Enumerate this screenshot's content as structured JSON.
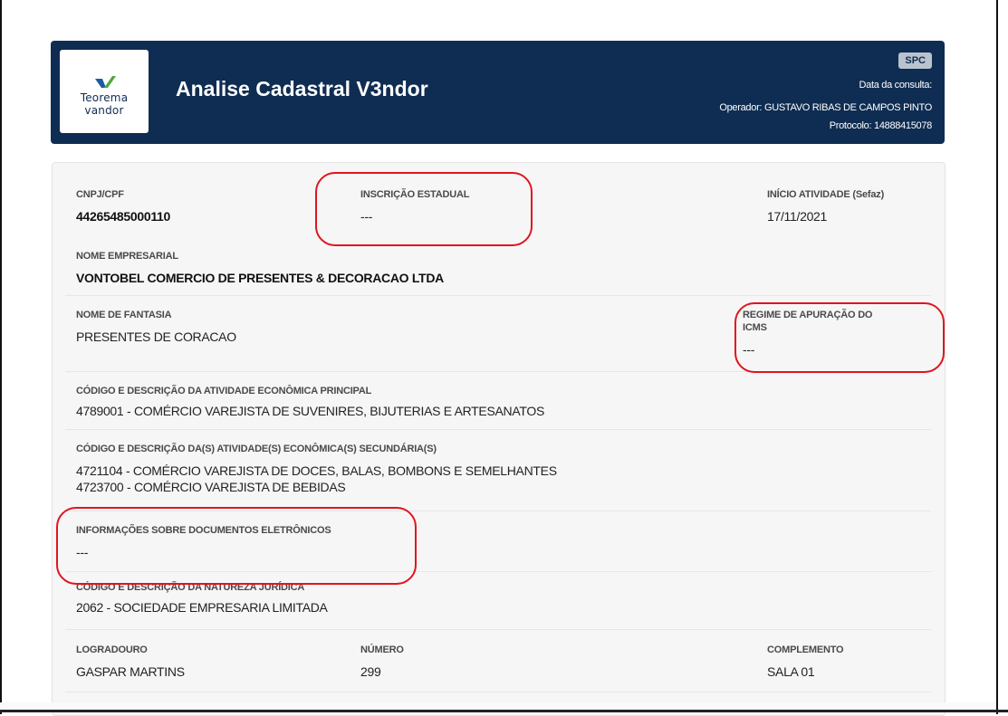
{
  "header": {
    "logo_line1": "Teorema",
    "logo_line2": "vandor",
    "title": "Analise Cadastral V3ndor",
    "badge": "SPC",
    "consult_date_label": "Data da consulta:",
    "operator": "Operador: GUSTAVO RIBAS DE CAMPOS PINTO",
    "protocol": "Protocolo: 14888415078",
    "colors": {
      "background": "#0f2d52",
      "accent": "#4fa83d"
    }
  },
  "fields": {
    "cnpj": {
      "label": "CNPJ/CPF",
      "value": "44265485000110"
    },
    "inscricao_estadual": {
      "label": "INSCRIÇÃO ESTADUAL",
      "value": "---"
    },
    "inicio_atividade": {
      "label": "INÍCIO ATIVIDADE (Sefaz)",
      "value": "17/11/2021"
    },
    "nome_empresarial": {
      "label": "NOME EMPRESARIAL",
      "value": "VONTOBEL COMERCIO DE PRESENTES & DECORACAO LTDA"
    },
    "nome_fantasia": {
      "label": "NOME DE FANTASIA",
      "value": "PRESENTES DE CORACAO"
    },
    "regime_icms": {
      "label_line1": "REGIME DE APURAÇÃO DO",
      "label_line2": "ICMS",
      "value": "---"
    },
    "atividade_principal": {
      "label": "CÓDIGO E DESCRIÇÃO DA ATIVIDADE ECONÔMICA PRINCIPAL",
      "value": "4789001 - COMÉRCIO VAREJISTA DE SUVENIRES, BIJUTERIAS E ARTESANATOS"
    },
    "atividades_secundarias": {
      "label": "CÓDIGO E DESCRIÇÃO DA(S) ATIVIDADE(S) ECONÔMICA(S) SECUNDÁRIA(S)",
      "values": [
        "4721104 - COMÉRCIO VAREJISTA DE DOCES, BALAS, BOMBONS E SEMELHANTES",
        "4723700 - COMÉRCIO VAREJISTA DE BEBIDAS"
      ]
    },
    "documentos_eletronicos": {
      "label": "INFORMAÇÕES SOBRE DOCUMENTOS ELETRÔNICOS",
      "value": "---"
    },
    "natureza_juridica": {
      "label": "CÓDIGO E DESCRIÇÃO DA NATUREZA JURÍDICA",
      "value": "2062 - SOCIEDADE EMPRESARIA LIMITADA"
    },
    "logradouro": {
      "label": "LOGRADOURO",
      "value": "GASPAR MARTINS"
    },
    "numero": {
      "label": "NÚMERO",
      "value": "299"
    },
    "complemento": {
      "label": "COMPLEMENTO",
      "value": "SALA 01"
    }
  },
  "annotations": {
    "highlight_color": "#e0141f"
  }
}
